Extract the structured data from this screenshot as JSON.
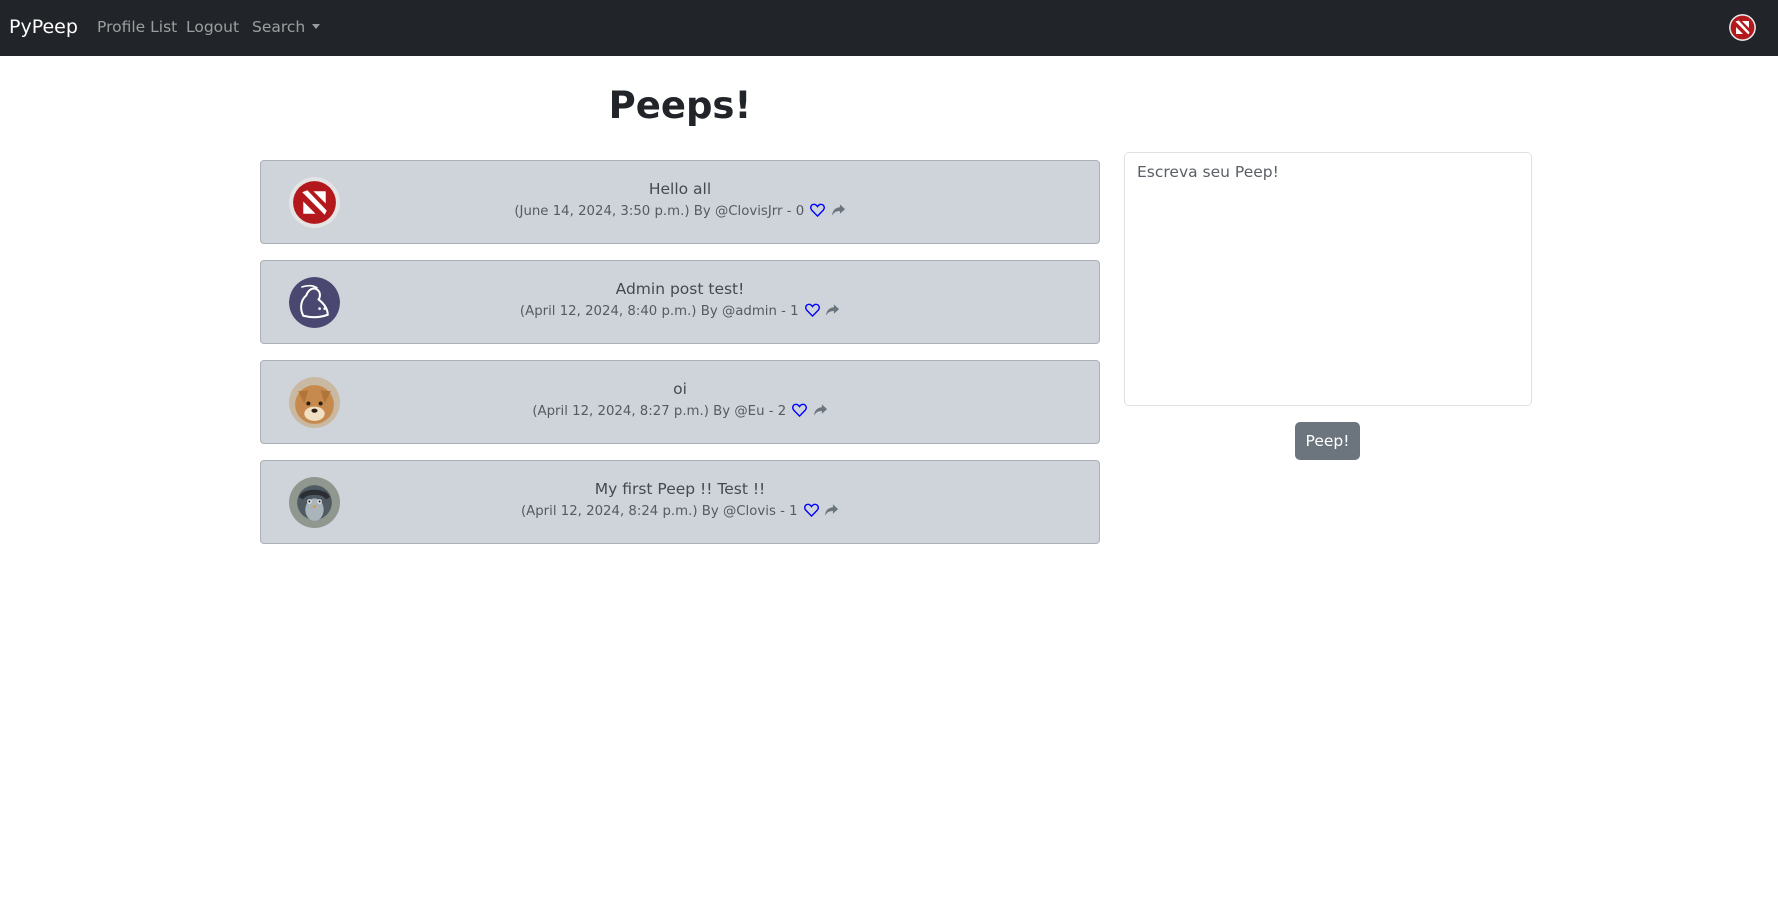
{
  "navbar": {
    "brand": "PyPeep",
    "links": {
      "profile_list": "Profile List",
      "logout": "Logout",
      "search": "Search"
    },
    "user_avatar_icon": "dota-logo-avatar"
  },
  "main": {
    "title": "Peeps!",
    "peeps": [
      {
        "text": "Hello all",
        "meta": "(June 14, 2024, 3:50 p.m.) By @ClovisJrr - 0",
        "avatar": "dota-logo-avatar"
      },
      {
        "text": "Admin post test!",
        "meta": "(April 12, 2024, 8:40 p.m.) By @admin - 1",
        "avatar": "peep-bird-avatar"
      },
      {
        "text": "oi",
        "meta": "(April 12, 2024, 8:27 p.m.) By @Eu - 2",
        "avatar": "dog-photo-avatar"
      },
      {
        "text": "My first Peep !! Test !!",
        "meta": "(April 12, 2024, 8:24 p.m.) By @Clovis - 1",
        "avatar": "penguin-photo-avatar"
      }
    ]
  },
  "compose": {
    "placeholder": "Escreva seu Peep!",
    "button_label": "Peep!"
  },
  "colors": {
    "navbar_bg": "#212529",
    "card_bg": "#ced4da",
    "like_icon": "#0000ff",
    "button_bg": "#6c757d"
  }
}
